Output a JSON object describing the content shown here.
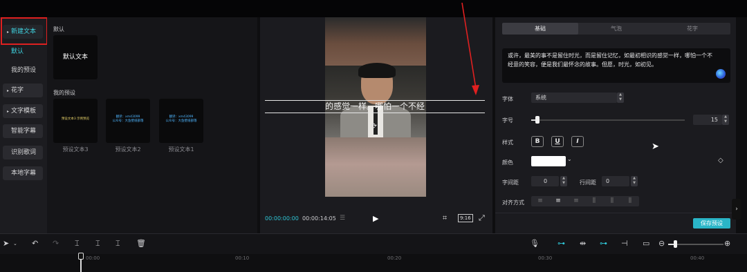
{
  "left_nav": {
    "items": [
      {
        "label": "新建文本",
        "expandable": true,
        "active": true
      },
      {
        "label": "默认",
        "active": true
      },
      {
        "label": "我的预设"
      },
      {
        "label": "花字",
        "expandable": true
      },
      {
        "label": "文字模板",
        "expandable": true
      },
      {
        "label": "智能字幕"
      },
      {
        "label": "识别歌词"
      },
      {
        "label": "本地字幕"
      }
    ]
  },
  "library": {
    "section_default": "默认",
    "default_card_label": "默认文本",
    "section_presets": "我的预设",
    "presets": [
      {
        "caption": "预设文本3",
        "preview_text": "预设文本3 示例预览"
      },
      {
        "caption": "预设文本2",
        "preview_line1": "翻译：xm43099",
        "preview_line2": "公众号：大鱼壁纸部落"
      },
      {
        "caption": "预设文本1",
        "preview_line1": "翻译：xm43099",
        "preview_line2": "公众号：大鱼壁纸部落"
      }
    ]
  },
  "player": {
    "subtitle": "的感觉一样。哪怕一个不经",
    "current_time": "00:00:00:00",
    "total_time": "00:00:14:05",
    "ratio_label": "9:16"
  },
  "panel": {
    "tabs": [
      "基础",
      "气泡",
      "花字"
    ],
    "selected_tab": "基础",
    "text_content": "或许，最美的事不是留住时光，而是留住记忆，如最初相识的感觉一样，哪怕一个不经意的笑容，便是我们最怀念的故事。但愿，时光，如初见。",
    "font_label": "字体",
    "font_value": "系统",
    "size_label": "字号",
    "size_value": "15",
    "style_label": "样式",
    "style_buttons": [
      "B",
      "U",
      "I"
    ],
    "color_label": "颜色",
    "color_value": "#ffffff",
    "letter_spacing_label": "字间距",
    "letter_spacing_value": "0",
    "line_spacing_label": "行间距",
    "line_spacing_value": "0",
    "align_label": "对齐方式",
    "save_button": "保存预设"
  },
  "timeline": {
    "ruler_labels": [
      "00:00",
      "00:10",
      "00:20",
      "00:30",
      "00:40"
    ]
  },
  "colors": {
    "accent": "#2fc6d6",
    "highlight": "#e02020"
  }
}
